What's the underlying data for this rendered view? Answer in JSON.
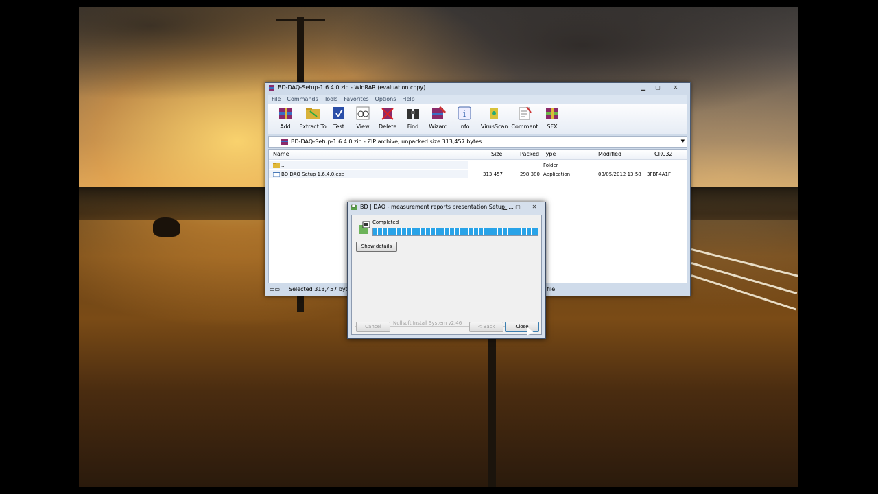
{
  "winrar": {
    "title": "BD-DAQ-Setup-1.6.4.0.zip - WinRAR (evaluation copy)",
    "menu": [
      "File",
      "Commands",
      "Tools",
      "Favorites",
      "Options",
      "Help"
    ],
    "toolbar": [
      "Add",
      "Extract To",
      "Test",
      "View",
      "Delete",
      "Find",
      "Wizard",
      "Info",
      "VirusScan",
      "Comment",
      "SFX"
    ],
    "path": "BD-DAQ-Setup-1.6.4.0.zip - ZIP archive, unpacked size 313,457 bytes",
    "columns": {
      "name": "Name",
      "size": "Size",
      "packed": "Packed",
      "type": "Type",
      "modified": "Modified",
      "crc": "CRC32"
    },
    "rows": [
      {
        "name": "..",
        "size": "",
        "packed": "",
        "type": "Folder",
        "modified": "",
        "crc": ""
      },
      {
        "name": "BD DAQ Setup 1.6.4.0.exe",
        "size": "313,457",
        "packed": "298,380",
        "type": "Application",
        "modified": "03/05/2012 13:58",
        "crc": "3FBF4A1F"
      }
    ],
    "status_left": "Selected 313,457 bytes in",
    "status_right": "file"
  },
  "installer": {
    "title": "BD | DAQ - measurement reports presentation Setup: ...",
    "status": "Completed",
    "progress": 1.0,
    "show_details": "Show details",
    "cancel": "Cancel",
    "branding": "Nullsoft Install System v2.46",
    "back": "< Back",
    "close": "Close"
  },
  "colors": {
    "progress": "#29a3e8",
    "titlebar": "#cfdbea"
  }
}
